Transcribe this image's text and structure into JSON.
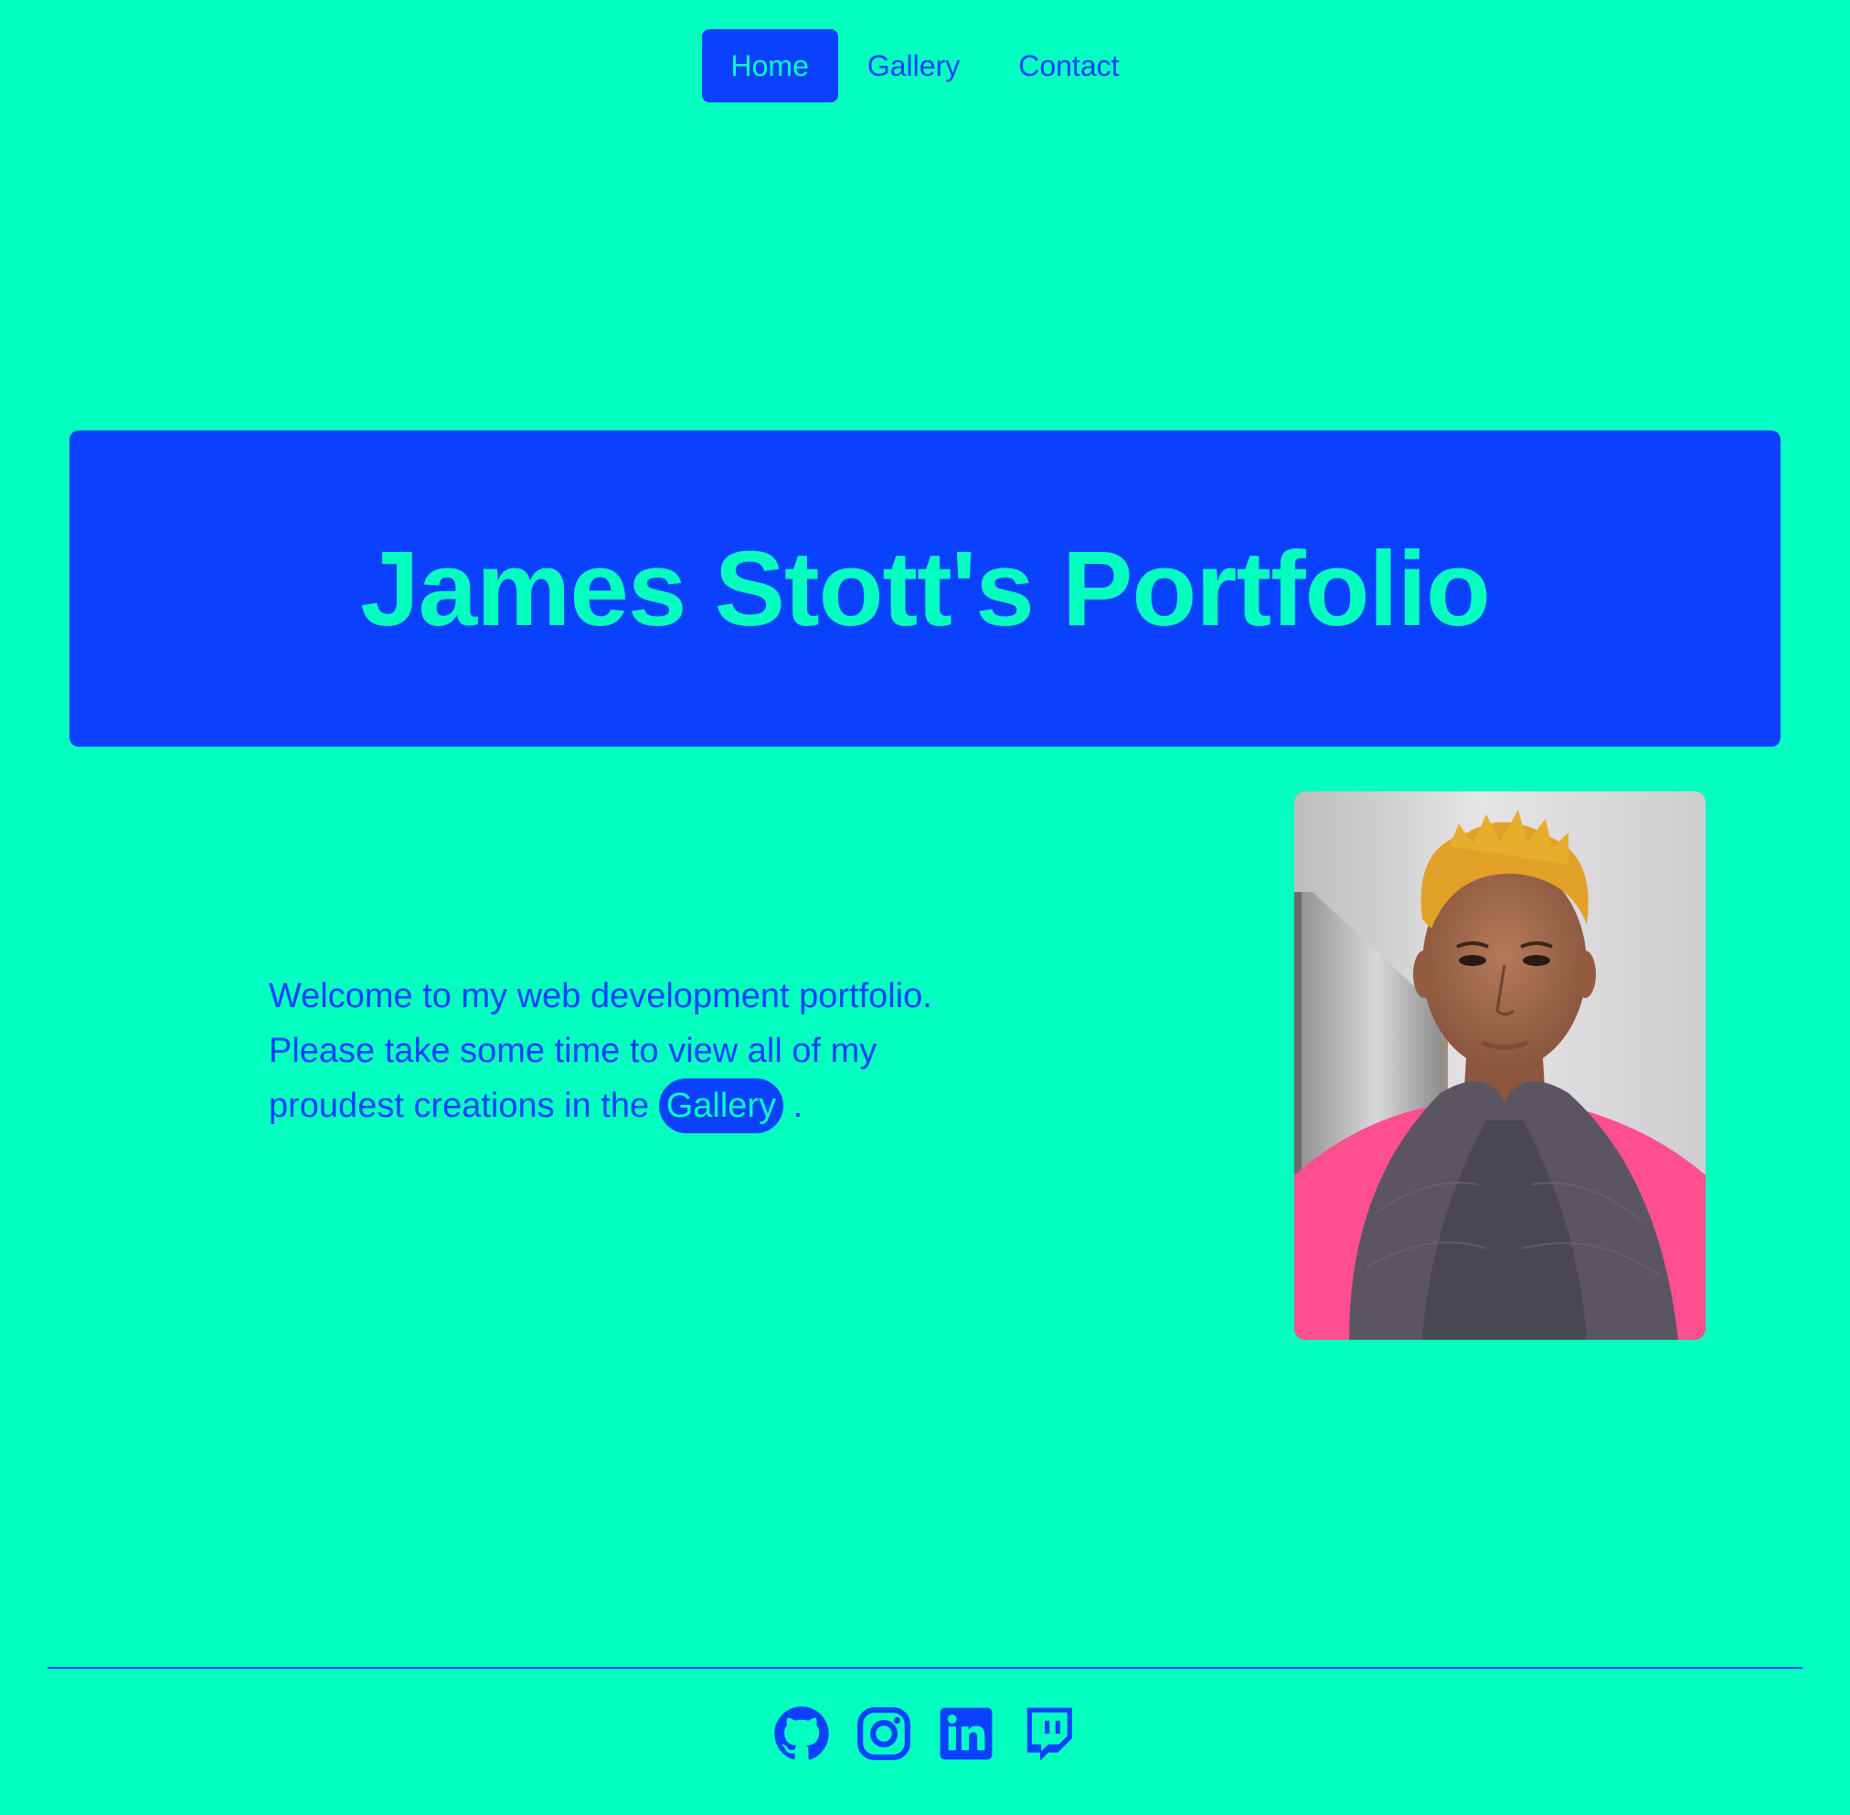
{
  "nav": {
    "items": [
      {
        "label": "Home",
        "active": true
      },
      {
        "label": "Gallery",
        "active": false
      },
      {
        "label": "Contact",
        "active": false
      }
    ]
  },
  "hero": {
    "title": "James Stott's Portfolio"
  },
  "intro": {
    "text_before": "Welcome to my web development portfolio. Please take some time to view all of my proudest creations in the",
    "link_label": "Gallery",
    "text_after": "."
  },
  "portrait": {
    "alt": "Portrait photo"
  },
  "footer": {
    "icons": [
      "github-icon",
      "instagram-icon",
      "linkedin-icon",
      "twitch-icon"
    ]
  },
  "colors": {
    "background": "#05FFC0",
    "accent": "#0A41FF"
  }
}
